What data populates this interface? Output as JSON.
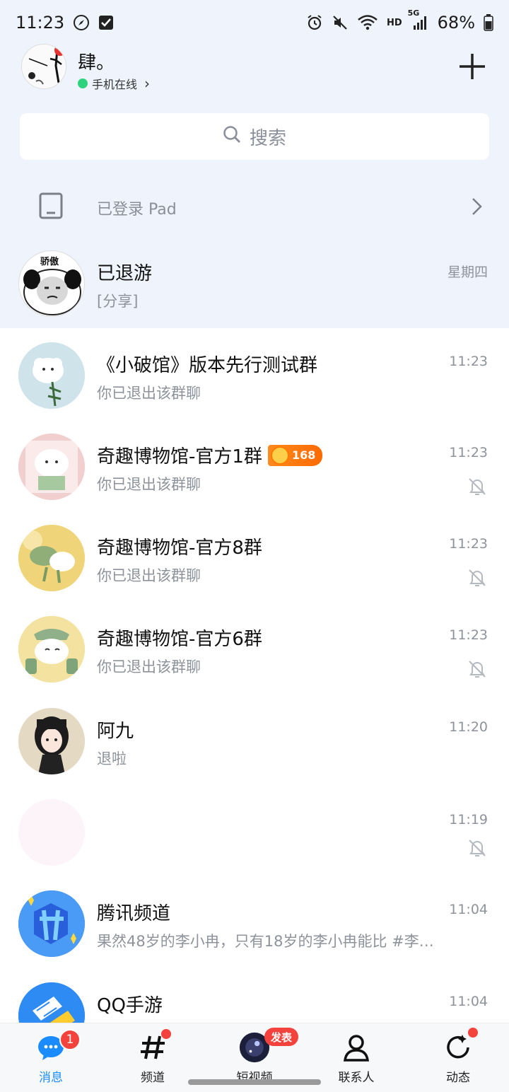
{
  "status_bar": {
    "time": "11:23",
    "network": "HD",
    "signal": "5G",
    "battery": "68%"
  },
  "header": {
    "profile_name": "肆。",
    "online_status": "手机在线",
    "online_chevron": "›"
  },
  "search": {
    "placeholder": "搜索"
  },
  "pad": {
    "label": "已登录 Pad"
  },
  "chats": [
    {
      "title": "已退游",
      "preview": "[分享]",
      "time": "星期四",
      "muted": false,
      "pinned": true,
      "avatar_text": "骄傲"
    },
    {
      "title": "《小破馆》版本先行测试群",
      "preview": "你已退出该群聊",
      "time": "11:23",
      "muted": false
    },
    {
      "title": "奇趣博物馆-官方1群",
      "preview": "你已退出该群聊",
      "time": "11:23",
      "muted": true,
      "badge": "168"
    },
    {
      "title": "奇趣博物馆-官方8群",
      "preview": "你已退出该群聊",
      "time": "11:23",
      "muted": true
    },
    {
      "title": "奇趣博物馆-官方6群",
      "preview": "你已退出该群聊",
      "time": "11:23",
      "muted": true
    },
    {
      "title": "阿九",
      "preview": "退啦",
      "time": "11:20",
      "muted": false
    },
    {
      "title": "",
      "preview": "",
      "time": "11:19",
      "muted": true,
      "faded": true
    },
    {
      "title": "腾讯频道",
      "preview": "果然48岁的李小冉，只有18岁的李小冉能比 #李…",
      "time": "11:04",
      "muted": false
    },
    {
      "title": "QQ手游",
      "preview": "",
      "time": "11:04",
      "muted": false
    }
  ],
  "nav": {
    "items": [
      {
        "label": "消息",
        "active": true,
        "badge": "1"
      },
      {
        "label": "频道",
        "active": false,
        "dot": true
      },
      {
        "label": "短视频",
        "active": false,
        "publish": "发表"
      },
      {
        "label": "联系人",
        "active": false
      },
      {
        "label": "动态",
        "active": false,
        "dot": true
      }
    ]
  },
  "colors": {
    "accent": "#1a8cff",
    "badge": "#f4433c",
    "online": "#2fd37d",
    "top_bg": "#eef3fc"
  }
}
